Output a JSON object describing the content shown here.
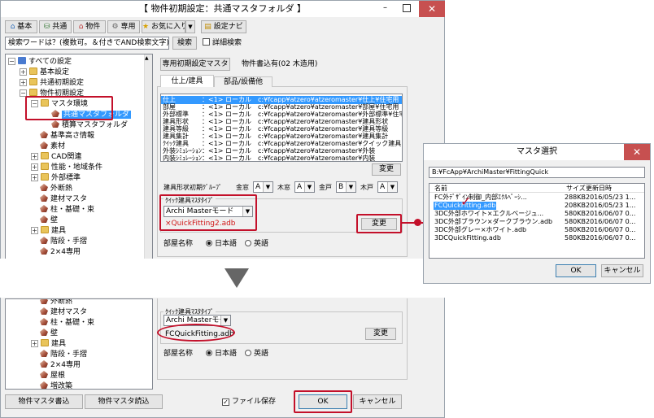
{
  "dialog": {
    "title": "【 物件初期設定：共通マスタフォルダ 】",
    "toolbar": {
      "basic": "基本",
      "common": "共通",
      "property": "物件",
      "exclusive": "専用",
      "favorites": "お気に入り",
      "settings_navi": "設定ナビ"
    },
    "search": {
      "placeholder": "検索ワードは？(複数可。＆付きでAND検索文字)",
      "button": "検索",
      "detail": "詳細検索"
    },
    "tree_top": [
      "すべての設定",
      "基本設定",
      "共通初期設定",
      "物件初期設定",
      "マスタ環境",
      "共通マスタフォルダ",
      "積算マスタフォルダ",
      "基準高さ情報",
      "素材",
      "CAD関連",
      "性能・地域条件",
      "外部標準",
      "外断熱",
      "建材マスタ",
      "柱・基礎・束",
      "壁",
      "建具",
      "階段・手摺",
      "2×4専用"
    ],
    "tree_bottom": [
      "外断熱",
      "建材マスタ",
      "柱・基礎・束",
      "壁",
      "建具",
      "階段・手摺",
      "2×4専用",
      "屋根",
      "増改築"
    ],
    "tabs_top": {
      "master": "専用初期設定マスタ",
      "property_write": "物件書込有(02 木造用)"
    },
    "subtabs": {
      "finish": "仕上/建具",
      "parts": "部品/設備他"
    },
    "folder_list": [
      "仕上　　　　：<1> ローカル　c:¥fcapp¥atzero¥atzeromaster¥仕上¥住宅用",
      "部屋　　　　：<1> ローカル　c:¥fcapp¥atzero¥atzeromaster¥部屋¥住宅用",
      "外部標準　　：<1> ローカル　c:¥fcapp¥atzero¥atzeromaster¥外部標準¥住宅用",
      "建具形状　　：<1> ローカル　c:¥fcapp¥atzero¥atzeromaster¥建具形状",
      "建具等級　　：<1> ローカル　c:¥fcapp¥atzero¥atzeromaster¥建具等級",
      "建具集計　　：<1> ローカル　c:¥fcapp¥atzero¥atzeromaster¥建具集計",
      "ｸｲｯｸ建具　　：<1> ローカル　c:¥fcapp¥atzero¥atzeromaster¥クイック建具",
      "外装ｼﾐｭﾚｰｼｮﾝ：<1> ローカル　c:¥fcapp¥atzero¥atzeromaster¥外装",
      "内装ｼﾐｭﾚｰｼｮﾝ：<1> ローカル　c:¥fcapp¥atzero¥atzeromaster¥内装"
    ],
    "change_button": "変更",
    "grade": {
      "label": "建具形状初期ｸﾞﾙｰﾌﾟ",
      "items": [
        {
          "label": "金窓",
          "value": "A"
        },
        {
          "label": "木窓",
          "value": "A"
        },
        {
          "label": "金戸",
          "value": "B"
        },
        {
          "label": "木戸",
          "value": "A"
        }
      ]
    },
    "quick_type_label": "ｸｲｯｸ建具ﾏｽﾀﾀｲﾌﾟ",
    "quick_type_value": "Archi Masterモード",
    "quick_file_before": "×QuickFitting2.adb",
    "quick_file_after": "FCQuickFitting.adb",
    "room_name": {
      "label": "部屋名称",
      "japanese": "日本語",
      "english": "英語"
    },
    "footer": {
      "write": "物件マスタ書込",
      "read": "物件マスタ読込",
      "save_file": "ファイル保存",
      "ok": "OK",
      "cancel": "キャンセル"
    }
  },
  "master_select": {
    "title": "マスタ選択",
    "path": "B:¥FcApp¥ArchiMaster¥FittingQuick",
    "columns": {
      "name": "名前",
      "size": "サイズ",
      "date": "更新日時"
    },
    "files": [
      {
        "name": "FC外ﾃﾞｻﾞｲﾝ制御_内部ｴｸﾙﾍﾟｰｼ...",
        "size": "288KB",
        "date": "2016/05/23 1..."
      },
      {
        "name": "FCQuickFitting.adb",
        "size": "208KB",
        "date": "2016/05/23 1..."
      },
      {
        "name": "3DC外部ホワイト×エクルベージュ...",
        "size": "580KB",
        "date": "2016/06/07 0..."
      },
      {
        "name": "3DC外部ブラウン×ダークブラウン.adb",
        "size": "580KB",
        "date": "2016/06/07 0..."
      },
      {
        "name": "3DC外部グレー×ホワイト.adb",
        "size": "580KB",
        "date": "2016/06/07 0..."
      },
      {
        "name": "3DCQuickFitting.adb",
        "size": "580KB",
        "date": "2016/06/07 0..."
      }
    ],
    "ok": "OK",
    "cancel": "キャンセル"
  },
  "colors": {
    "highlight": "#c3102a",
    "selection": "#3399ff",
    "arrow": "#666666"
  }
}
